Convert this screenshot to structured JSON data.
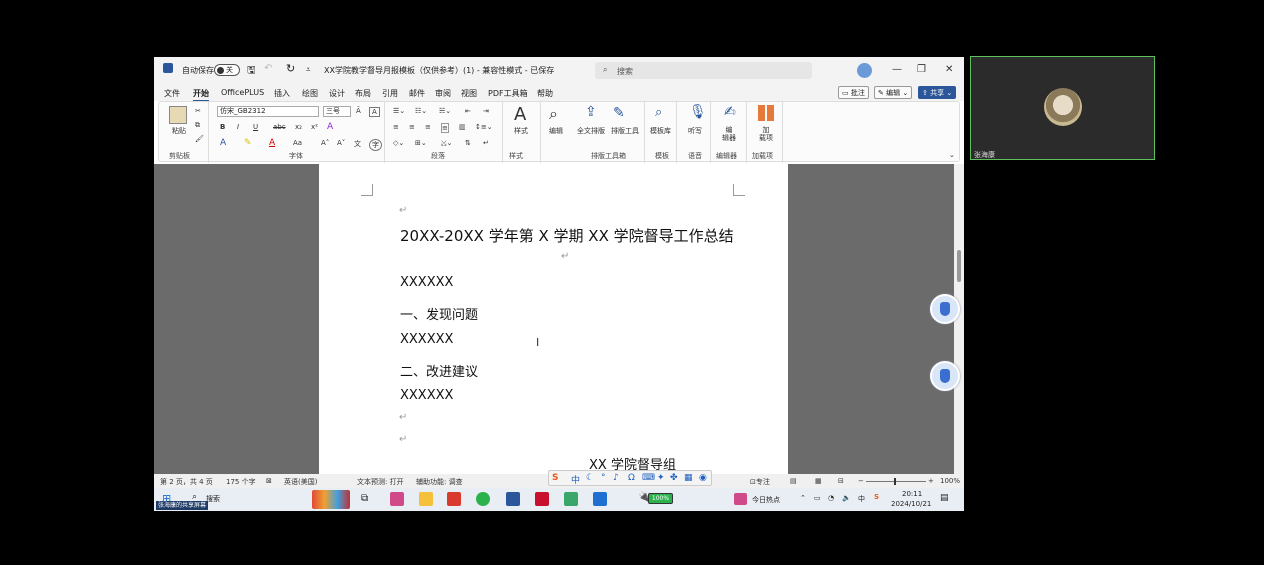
{
  "titlebar": {
    "autosave_label": "自动保存",
    "autosave_state": "关",
    "doc_title": "XX学院教学督导月报模板（仅供参考）(1) - 兼容性模式 - 已保存",
    "search_placeholder": "搜索"
  },
  "menu": {
    "items": [
      "文件",
      "开始",
      "OfficePLUS",
      "插入",
      "绘图",
      "设计",
      "布局",
      "引用",
      "邮件",
      "审阅",
      "视图",
      "PDF工具箱",
      "帮助"
    ],
    "active": "开始",
    "comment_btn": "批注",
    "edit_btn": "编辑",
    "share_btn": "共享"
  },
  "ribbon": {
    "clipboard": {
      "paste": "粘贴",
      "label": "剪贴板"
    },
    "font": {
      "name": "仿宋_GB2312",
      "size": "三号",
      "label": "字体",
      "bold": "B",
      "italic": "I",
      "underline": "U",
      "strike": "abc",
      "sub": "x₂",
      "sup": "x²",
      "grow": "A˄",
      "shrink": "A˅",
      "case": "Aa"
    },
    "paragraph": {
      "label": "段落"
    },
    "styles": {
      "styles": "样式",
      "label": "样式"
    },
    "editing": {
      "edit": "编辑"
    },
    "typeset": {
      "full": "全文排版",
      "tools": "排版工具",
      "label": "排版工具箱"
    },
    "template": {
      "lib": "模板库",
      "label": "模板"
    },
    "voice": {
      "dictate": "听写",
      "label": "语音"
    },
    "editor": {
      "editor": "编\n辑器",
      "label": "编辑器"
    },
    "addins": {
      "addins": "加\n载项",
      "label": "加载项"
    }
  },
  "document": {
    "title": "20XX-20XX 学年第 X 学期 XX 学院督导工作总结",
    "lines": [
      "XXXXXX",
      "一、发现问题",
      "XXXXXX",
      "二、改进建议",
      "XXXXXX"
    ],
    "signature": "XX 学院督导组",
    "return_mark": "↵"
  },
  "statusbar": {
    "page": "第 2 页，共 4 页",
    "words": "175 个字",
    "lang": "英语(美国)",
    "prediction": "文本预测: 打开",
    "accessibility": "辅助功能: 调查",
    "focus": "专注",
    "zoom": "100%"
  },
  "taskbar": {
    "search": "搜索",
    "overlay_label": "张海康的共享屏幕",
    "battery": "100%",
    "news": "今日热点",
    "ime_lang": "中",
    "time": "20:11",
    "date": "2024/10/21"
  },
  "ime": {
    "lang": "中"
  },
  "webcam": {
    "name": "张海康"
  },
  "colors": {
    "accent": "#2b579a",
    "cam_border": "#5fbf5f"
  }
}
